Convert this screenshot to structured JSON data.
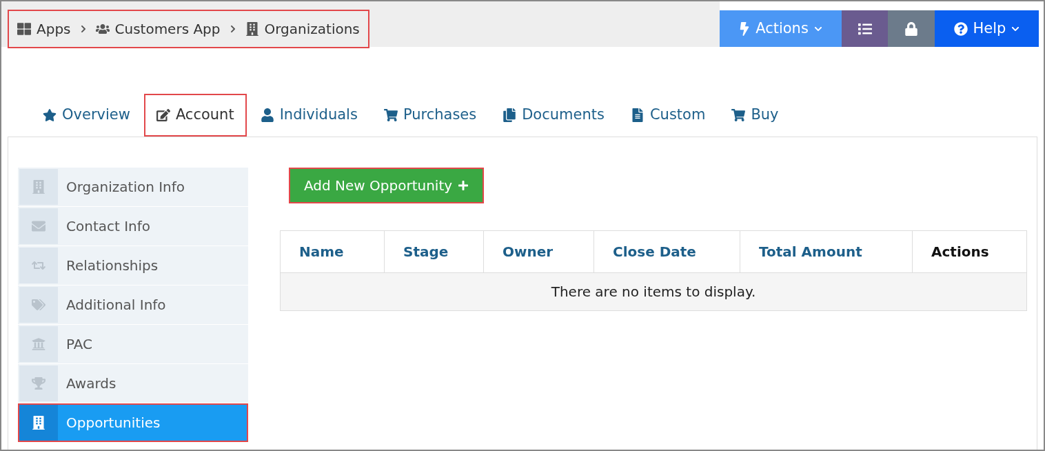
{
  "breadcrumb": {
    "highlighted": true,
    "items": [
      "Apps",
      "Customers App",
      "Organizations"
    ]
  },
  "toolbar": [
    {
      "kind": "actions",
      "label": "Actions"
    },
    {
      "kind": "list"
    },
    {
      "kind": "lock"
    },
    {
      "kind": "help",
      "label": "Help"
    }
  ],
  "tabs": [
    {
      "label": "Overview",
      "selected": false,
      "highlighted": false
    },
    {
      "label": "Account",
      "selected": true,
      "highlighted": true
    },
    {
      "label": "Individuals",
      "selected": false,
      "highlighted": false
    },
    {
      "label": "Purchases",
      "selected": false,
      "highlighted": false
    },
    {
      "label": "Documents",
      "selected": false,
      "highlighted": false
    },
    {
      "label": "Custom",
      "selected": false,
      "highlighted": false
    },
    {
      "label": "Buy",
      "selected": false,
      "highlighted": false
    }
  ],
  "sidebar": {
    "items": [
      {
        "label": "Organization Info",
        "selected": false,
        "highlighted": false
      },
      {
        "label": "Contact Info",
        "selected": false,
        "highlighted": false
      },
      {
        "label": "Relationships",
        "selected": false,
        "highlighted": false
      },
      {
        "label": "Additional Info",
        "selected": false,
        "highlighted": false
      },
      {
        "label": "PAC",
        "selected": false,
        "highlighted": false
      },
      {
        "label": "Awards",
        "selected": false,
        "highlighted": false
      },
      {
        "label": "Opportunities",
        "selected": true,
        "highlighted": true
      }
    ]
  },
  "add_button": {
    "label": "Add New Opportunity",
    "highlighted": true
  },
  "table": {
    "columns": [
      {
        "label": "Name",
        "sortable": true
      },
      {
        "label": "Stage",
        "sortable": true
      },
      {
        "label": "Owner",
        "sortable": true
      },
      {
        "label": "Close Date",
        "sortable": true
      },
      {
        "label": "Total Amount",
        "sortable": true
      },
      {
        "label": "Actions",
        "sortable": false
      }
    ],
    "empty_message": "There are no items to display."
  }
}
